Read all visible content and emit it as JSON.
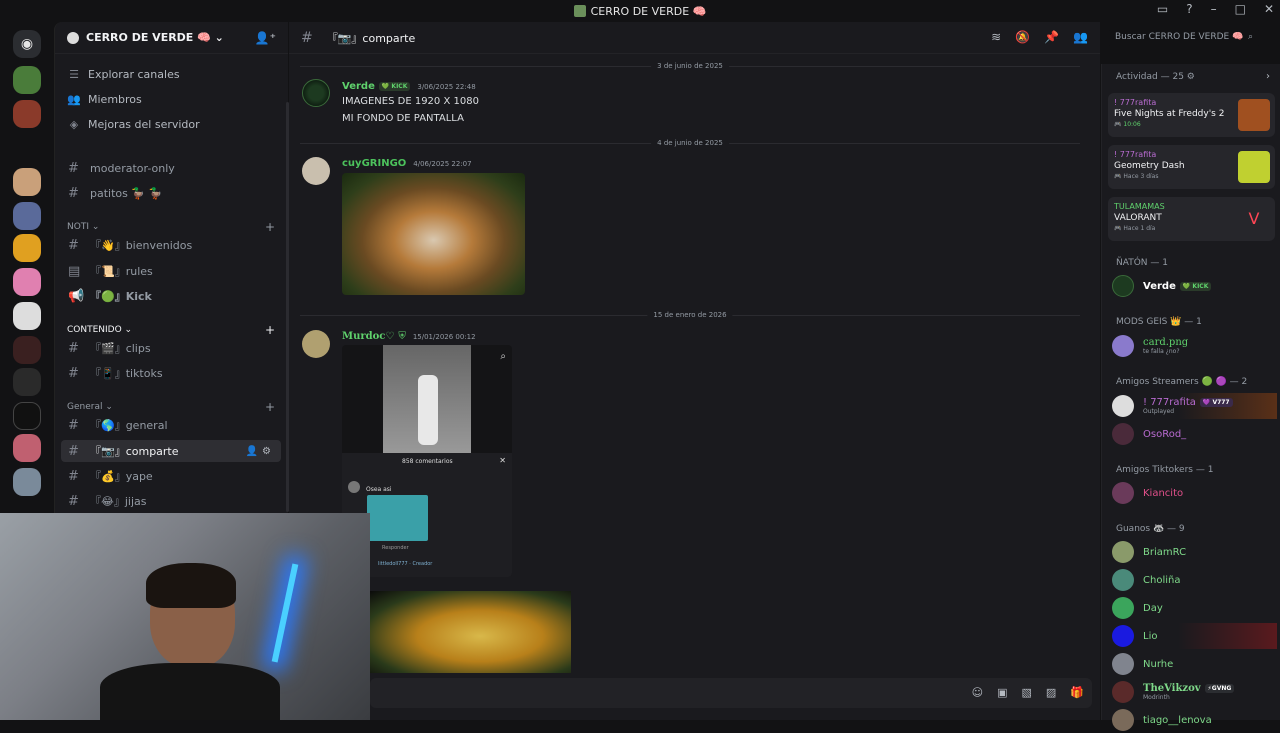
{
  "window": {
    "title": "CERRO DE VERDE 🧠"
  },
  "server": {
    "name": "CERRO DE VERDE 🧠 ⌄"
  },
  "nav": [
    {
      "label": "Explorar canales"
    },
    {
      "label": "Miembros"
    },
    {
      "label": "Mejoras del servidor"
    }
  ],
  "channels_top": [
    {
      "label": "moderator-only"
    },
    {
      "label": "patitos 🦆 🦆"
    }
  ],
  "categories": {
    "noti": "NOTI ⌄",
    "contenido": "CONTENIDO ⌄",
    "general": "General ⌄"
  },
  "channels_noti": [
    {
      "label": "『👋』bienvenidos"
    },
    {
      "label": "『📜』rules"
    },
    {
      "label": "『🟢』Kick"
    }
  ],
  "channels_contenido": [
    {
      "label": "『🎬』clips"
    },
    {
      "label": "『📱』tiktoks"
    }
  ],
  "channels_general": [
    {
      "label": "『🌎』general"
    },
    {
      "label": "『📷』comparte"
    },
    {
      "label": "『💰』yape"
    },
    {
      "label": "『😂』jijas"
    }
  ],
  "header": {
    "channel": "『📷』comparte",
    "search_placeholder": "Buscar CERRO DE VERDE 🧠"
  },
  "dividers": [
    "3 de junio de 2025",
    "4 de junio de 2025",
    "15 de enero de 2026"
  ],
  "messages": [
    {
      "author": "Verde",
      "badge": "KICK",
      "time": "3/06/2025 22:48",
      "lines": [
        "IMAGENES DE 1920 X 1080",
        "MI FONDO DE PANTALLA"
      ],
      "color": "#5fd16c"
    },
    {
      "author": "cuyGRINGO",
      "time": "4/06/2025 22:07",
      "color": "#4cc25c"
    },
    {
      "author": "Murdoc♡",
      "time": "15/01/2026 00:12",
      "color": "#5fd16c"
    }
  ],
  "embed": {
    "comments": "858 comentarios",
    "reply": "Responder",
    "creator": "littledoll777 · Creador",
    "comment_text": "Osea asi"
  },
  "activity": {
    "header": "Actividad — 25 ⚙",
    "cards": [
      {
        "user": "! 777rafita",
        "game": "Five Nights at Freddy's 2",
        "time": "🎮 10:06"
      },
      {
        "user": "! 777rafita",
        "game": "Geometry Dash",
        "time": "🎮 Hace 3 días"
      },
      {
        "user": "TULAMAMAS",
        "game": "VALORANT",
        "time": "🎮 Hace 1 día"
      }
    ]
  },
  "member_groups": [
    {
      "title": "ÑATÓN — 1"
    },
    {
      "title": "MODS GEIS 👑 — 1"
    },
    {
      "title": "Amigos Streamers 🟢 🟣 — 2"
    },
    {
      "title": "Amigos Tiktokers — 1"
    },
    {
      "title": "Guanos 🦝 — 9"
    }
  ],
  "members": [
    {
      "name": "Verde",
      "badge": "KICK",
      "color": "#ffffff"
    },
    {
      "name": "card.png",
      "sub": "te falla ¿no?",
      "color": "#5fd16c"
    },
    {
      "name": "! 777rafita",
      "badge": "V777",
      "sub": "Outplayed",
      "color": "#b86bd0"
    },
    {
      "name": "OsoRod_",
      "color": "#b86bd0"
    },
    {
      "name": "Kiancito",
      "color": "#e0508a"
    },
    {
      "name": "BriamRC",
      "color": "#7fd98a"
    },
    {
      "name": "Choliña",
      "color": "#7fd98a"
    },
    {
      "name": "Day",
      "color": "#7fd98a"
    },
    {
      "name": "Lio",
      "color": "#7fd98a"
    },
    {
      "name": "Nurhe",
      "color": "#7fd98a"
    },
    {
      "name": "TheVikzov",
      "badge": "GVNG",
      "sub": "Modrinth",
      "color": "#7fd98a"
    },
    {
      "name": "tiago__lenova",
      "color": "#7fd98a"
    }
  ]
}
